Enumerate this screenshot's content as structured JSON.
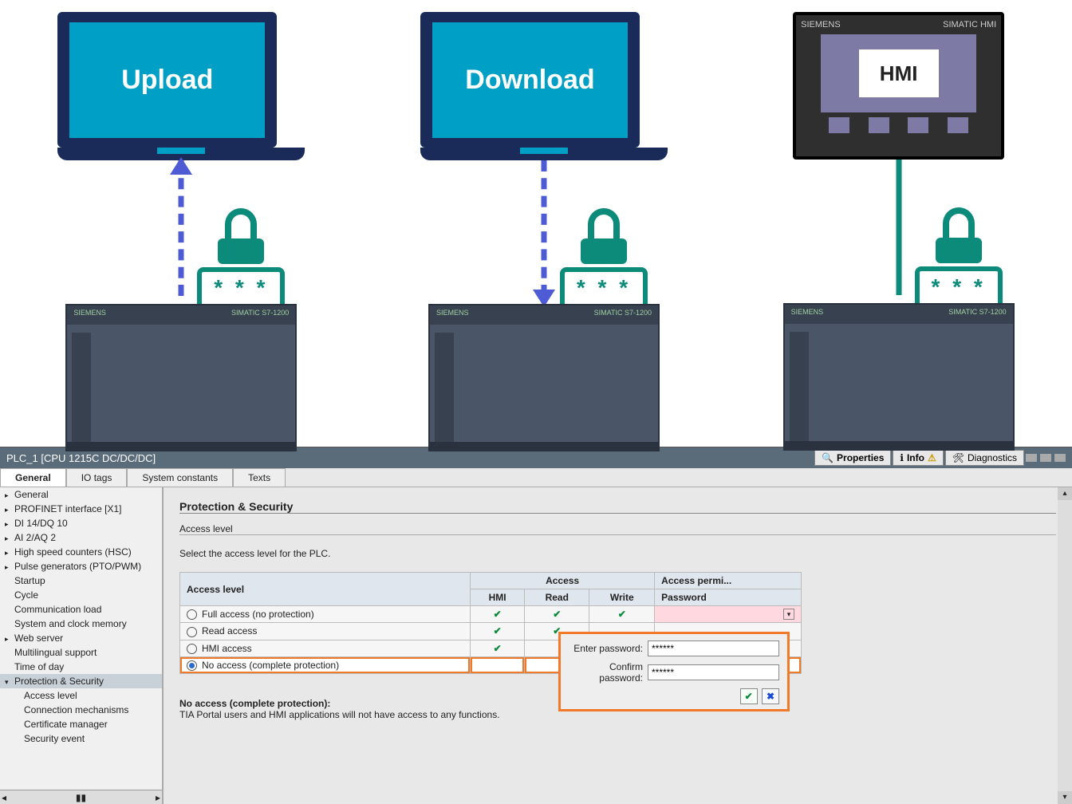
{
  "diagram": {
    "upload_label": "Upload",
    "download_label": "Download",
    "hmi_label": "HMI",
    "hmi_brand": "SIEMENS",
    "hmi_model": "SIMATIC HMI",
    "plc_brand": "SIEMENS",
    "plc_model": "SIMATIC S7-1200",
    "pwd_stars": "* * * *"
  },
  "titlebar": {
    "title": "PLC_1 [CPU 1215C DC/DC/DC]",
    "buttons": {
      "properties": "Properties",
      "info": "Info",
      "diagnostics": "Diagnostics"
    }
  },
  "tabs": {
    "general": "General",
    "iotags": "IO tags",
    "sysconst": "System constants",
    "texts": "Texts"
  },
  "nav": [
    {
      "label": "General",
      "exp": true
    },
    {
      "label": "PROFINET interface [X1]",
      "exp": true
    },
    {
      "label": "DI 14/DQ 10",
      "exp": true
    },
    {
      "label": "AI 2/AQ 2",
      "exp": true
    },
    {
      "label": "High speed counters (HSC)",
      "exp": true
    },
    {
      "label": "Pulse generators (PTO/PWM)",
      "exp": true
    },
    {
      "label": "Startup"
    },
    {
      "label": "Cycle"
    },
    {
      "label": "Communication load"
    },
    {
      "label": "System and clock memory"
    },
    {
      "label": "Web server",
      "exp": true
    },
    {
      "label": "Multilingual support"
    },
    {
      "label": "Time of day"
    },
    {
      "label": "Protection & Security",
      "exp": true,
      "sel": true
    },
    {
      "label": "Access level",
      "l2": true
    },
    {
      "label": "Connection mechanisms",
      "l2": true
    },
    {
      "label": "Certificate manager",
      "l2": true
    },
    {
      "label": "Security event",
      "l2": true
    }
  ],
  "content": {
    "section_title": "Protection & Security",
    "sub_title": "Access level",
    "hint": "Select the access level for the PLC.",
    "table": {
      "headers": {
        "access_level": "Access level",
        "access": "Access",
        "hmi": "HMI",
        "read": "Read",
        "write": "Write",
        "perm": "Access permi...",
        "password": "Password"
      },
      "rows": [
        {
          "label": "Full access (no protection)",
          "hmi": true,
          "read": true,
          "write": true,
          "pink": true
        },
        {
          "label": "Read access",
          "hmi": true,
          "read": true,
          "write": false
        },
        {
          "label": "HMI access",
          "hmi": true,
          "read": false,
          "write": false
        },
        {
          "label": "No access (complete protection)",
          "hmi": false,
          "read": false,
          "write": false,
          "selected": true
        }
      ]
    },
    "popup": {
      "enter": "Enter password:",
      "confirm": "Confirm password:",
      "value": "******"
    },
    "note_header": "No access (complete protection):",
    "note_text": "TIA Portal users and HMI applications will not have access to any functions."
  }
}
